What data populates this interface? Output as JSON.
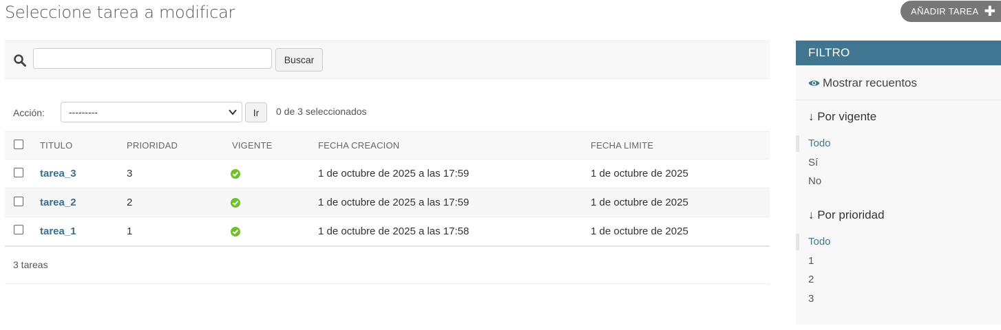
{
  "header": {
    "title": "Seleccione tarea a modificar",
    "add_label": "AÑADIR TAREA"
  },
  "search": {
    "button_label": "Buscar",
    "value": ""
  },
  "actions": {
    "label": "Acción:",
    "selected_option": "---------",
    "go_label": "Ir",
    "selected_count": "0 de 3 seleccionados"
  },
  "table": {
    "columns": [
      "TITULO",
      "PRIORIDAD",
      "VIGENTE",
      "FECHA CREACION",
      "FECHA LIMITE"
    ],
    "rows": [
      {
        "titulo": "tarea_3",
        "prioridad": "3",
        "vigente": true,
        "creacion": "1 de octubre de 2025 a las 17:59",
        "limite": "1 de octubre de 2025"
      },
      {
        "titulo": "tarea_2",
        "prioridad": "2",
        "vigente": true,
        "creacion": "1 de octubre de 2025 a las 17:59",
        "limite": "1 de octubre de 2025"
      },
      {
        "titulo": "tarea_1",
        "prioridad": "1",
        "vigente": true,
        "creacion": "1 de octubre de 2025 a las 17:58",
        "limite": "1 de octubre de 2025"
      }
    ]
  },
  "footer": {
    "count": "3 tareas"
  },
  "filter": {
    "title": "FILTRO",
    "show_counts": "Mostrar recuentos",
    "groups": [
      {
        "title": "↓ Por vigente",
        "options": [
          "Todo",
          "Sí",
          "No"
        ],
        "selected": "Todo"
      },
      {
        "title": "↓ Por prioridad",
        "options": [
          "Todo",
          "1",
          "2",
          "3"
        ],
        "selected": "Todo"
      }
    ]
  },
  "colors": {
    "accent": "#417690",
    "link": "#3a6e8c",
    "success": "#70bf2b",
    "button": "#777777"
  }
}
